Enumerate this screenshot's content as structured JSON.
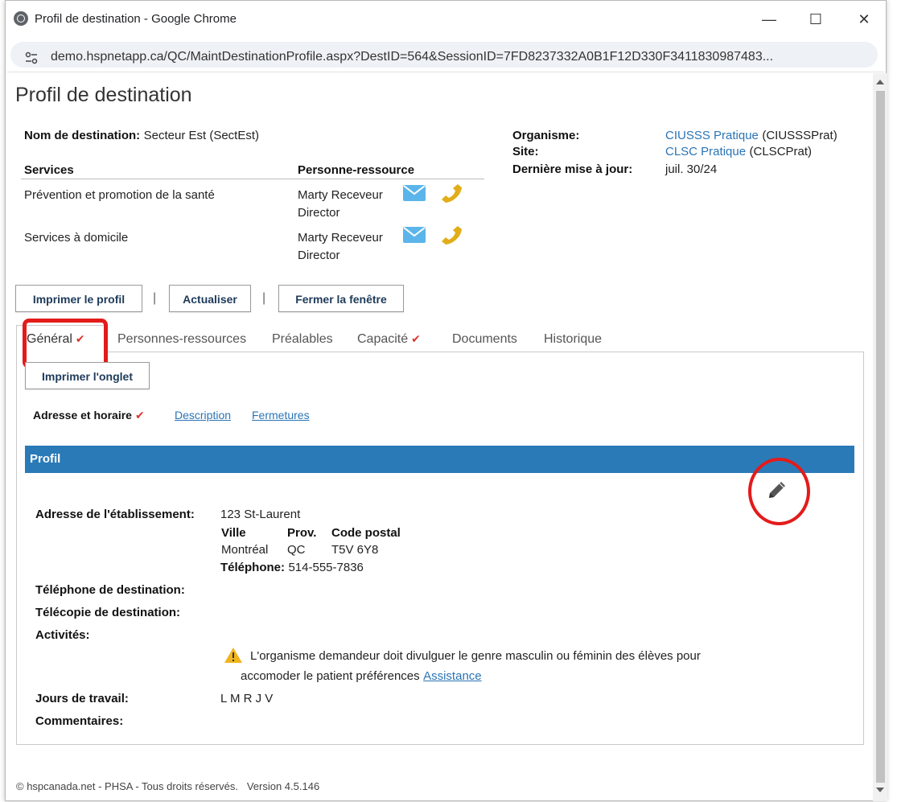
{
  "browser": {
    "window_title": "Profil de destination - Google Chrome",
    "url": "demo.hspnetapp.ca/QC/MaintDestinationProfile.aspx?DestID=564&SessionID=7FD8237332A0B1F12D330F3411830987483...",
    "minimize_glyph": "—",
    "maximize_glyph": "☐",
    "close_glyph": "✕"
  },
  "page": {
    "title": "Profil de destination",
    "destination_name_label": "Nom de destination:",
    "destination_name_value": "Secteur Est (SectEst)",
    "organisme_label": "Organisme:",
    "organisme_link": "CIUSSS Pratique",
    "organisme_code": "(CIUSSSPrat)",
    "site_label": "Site:",
    "site_link": "CLSC Pratique",
    "site_code": "(CLSCPrat)",
    "updated_label": "Dernière mise à jour:",
    "updated_value": "juil. 30/24"
  },
  "services": {
    "col_services": "Services",
    "col_contact": "Personne-ressource",
    "rows": [
      {
        "service": "Prévention et promotion de la santé",
        "contact_name": "Marty Receveur",
        "contact_role": "Director"
      },
      {
        "service": "Services à domicile",
        "contact_name": "Marty Receveur",
        "contact_role": "Director"
      }
    ]
  },
  "actions": {
    "print_profile": "Imprimer le profil",
    "refresh": "Actualiser",
    "close_window": "Fermer la fenêtre",
    "separator": "|"
  },
  "tabs": [
    {
      "label": "Général",
      "checked": true
    },
    {
      "label": "Personnes-ressources",
      "checked": false
    },
    {
      "label": "Préalables",
      "checked": false
    },
    {
      "label": "Capacité",
      "checked": true
    },
    {
      "label": "Documents",
      "checked": false
    },
    {
      "label": "Historique",
      "checked": false
    }
  ],
  "check_glyph": "✔",
  "panel": {
    "print_tab": "Imprimer l'onglet",
    "subtab_active": "Adresse et horaire",
    "subtab_description": "Description",
    "subtab_closures": "Fermetures",
    "section_title": "Profil",
    "address_label": "Adresse de l'établissement:",
    "address_line": "123 St-Laurent",
    "city_label": "Ville",
    "prov_label": "Prov.",
    "postal_label": "Code postal",
    "city_value": "Montréal",
    "prov_value": "QC",
    "postal_value": "T5V 6Y8",
    "phone_label": "Téléphone:",
    "phone_value": "514-555-7836",
    "dest_phone_label": "Téléphone de destination:",
    "dest_fax_label": "Télécopie de destination:",
    "activities_label": "Activités:",
    "warning_line1": "L'organisme demandeur doit divulguer le genre masculin ou féminin des élèves pour",
    "warning_line2": "accomoder le patient préférences",
    "assistance_link": "Assistance",
    "workdays_label": "Jours de travail:",
    "workdays_value": "L M R J V",
    "comments_label": "Commentaires:"
  },
  "footer": {
    "copyright": "© hspcanada.net - PHSA - Tous droits réservés.",
    "version": "Version 4.5.146"
  },
  "colors": {
    "accent_blue": "#2a7ab8",
    "link_blue": "#2a74b5",
    "check_red": "#d9362e",
    "annotation_red": "#e31b1b",
    "mail_icon": "#5bb5ea",
    "phone_icon": "#e2ad18"
  }
}
